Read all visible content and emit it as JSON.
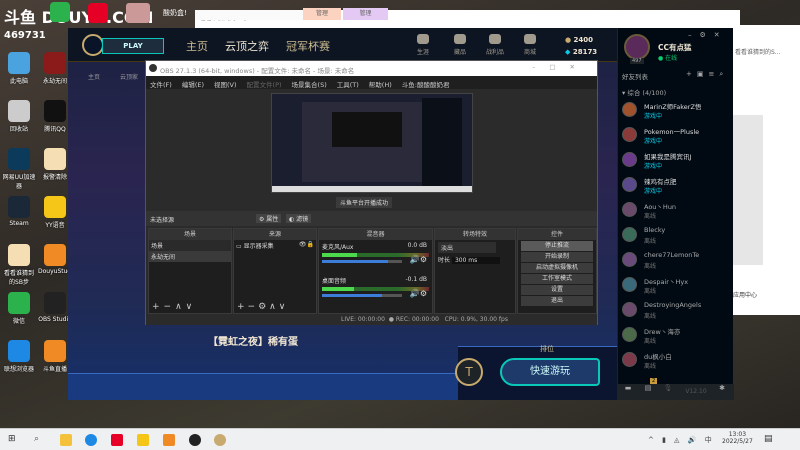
{
  "watermark": {
    "logo": "斗鱼 DOUYU.COM",
    "room_id": "469731"
  },
  "top_strip": {
    "streamer_name": "酸奶盒!"
  },
  "desktop_icons": [
    "此电脑",
    "回收站",
    "网易UU加速器",
    "Steam",
    "看看谁猜到的SB步",
    "微信",
    "联想浏览器"
  ],
  "desktop_icons_col2": [
    "永劫无间",
    "腾讯QQ",
    "报警清除",
    "YY语音",
    "DouyuStudio",
    "OBS Studio",
    "斗鱼直播"
  ],
  "bg_window": {
    "title": "看看谁猜到的SB步",
    "tab1": "管理",
    "tab2": "管理",
    "side_text": "看看谁猜到的S...",
    "footer": "应用中心"
  },
  "lol": {
    "play": "PLAY",
    "nav": [
      "主页",
      "云顶之弈",
      "冠军杯赛"
    ],
    "subnav": [
      "主页",
      "云顶家"
    ],
    "icons": [
      "生涯",
      "藏品",
      "战利品",
      "商城"
    ],
    "rp": "2400",
    "be": "28173",
    "event_text": "【霓虹之夜】稀有蛋",
    "queue_label": "排位",
    "quick_play": "快速游玩"
  },
  "friends": {
    "name": "CC有点猛",
    "status": "在线",
    "level": "497",
    "header": "好友列表",
    "group": "综合 (4/100)",
    "version": "V12.10",
    "badge": "2",
    "list": [
      {
        "name": "MarinZ师FakerZ悟",
        "status": "游戏中",
        "online": true,
        "color": "#a0522d"
      },
      {
        "name": "Pokemon一Plusle",
        "status": "游戏中",
        "online": true,
        "color": "#8b3a3a"
      },
      {
        "name": "如果我是腾宾讯J",
        "status": "游戏中",
        "online": true,
        "color": "#6a3a8b"
      },
      {
        "name": "辣鸡有点肥",
        "status": "游戏中",
        "online": true,
        "color": "#5a4a8b"
      },
      {
        "name": "Aou丶Hun",
        "status": "离线",
        "online": false,
        "color": "#6a4a6a"
      },
      {
        "name": "Blecky",
        "status": "离线",
        "online": false,
        "color": "#3a6a5a"
      },
      {
        "name": "chere77LemonTe",
        "status": "离线",
        "online": false,
        "color": "#6a4a7a"
      },
      {
        "name": "Despair丶Hyx",
        "status": "离线",
        "online": false,
        "color": "#3a6a7a"
      },
      {
        "name": "DestroyingAngels",
        "status": "离线",
        "online": false,
        "color": "#6a4a6a"
      },
      {
        "name": "Drew丶海亦",
        "status": "离线",
        "online": false,
        "color": "#4a6a4a"
      },
      {
        "name": "du枫小白",
        "status": "离线",
        "online": false,
        "color": "#7a3a4a"
      }
    ]
  },
  "obs": {
    "title": "OBS 27.1.3 (64-bit, windows) - 配置文件: 未命名 - 场景: 未命名",
    "menu": [
      "文件(F)",
      "编辑(E)",
      "视图(V)",
      "配置文件(P)",
      "场景集合(S)",
      "工具(T)",
      "帮助(H)",
      "斗鱼:酸酸酸奶君"
    ],
    "preview_toast": "斗鱼平台开播成功",
    "no_source": "未选择源",
    "properties": "属性",
    "filters": "滤镜",
    "docks": {
      "scenes": "场景",
      "sources": "来源",
      "mixer": "混音器",
      "transitions": "转场特效",
      "controls": "控件"
    },
    "scenes": [
      "场景",
      "永劫无间"
    ],
    "sources": [
      "显示器采集"
    ],
    "mixer": [
      {
        "name": "麦克风/Aux",
        "db": "0.0 dB",
        "level": 0.82
      },
      {
        "name": "桌面音频",
        "db": "-0.1 dB",
        "level": 0.75
      }
    ],
    "transition": "淡出",
    "duration_label": "时长",
    "duration": "300 ms",
    "controls": [
      "停止推流",
      "开始录制",
      "启动虚拟摄像机",
      "工作室模式",
      "设置",
      "退出"
    ],
    "status": {
      "live": "LIVE: 00:00:00",
      "rec": "REC: 00:00:00",
      "cpu": "CPU: 0.9%, 30.00 fps"
    }
  },
  "taskbar": {
    "time": "13:03",
    "date": "2022/5/27",
    "ime": "中"
  }
}
